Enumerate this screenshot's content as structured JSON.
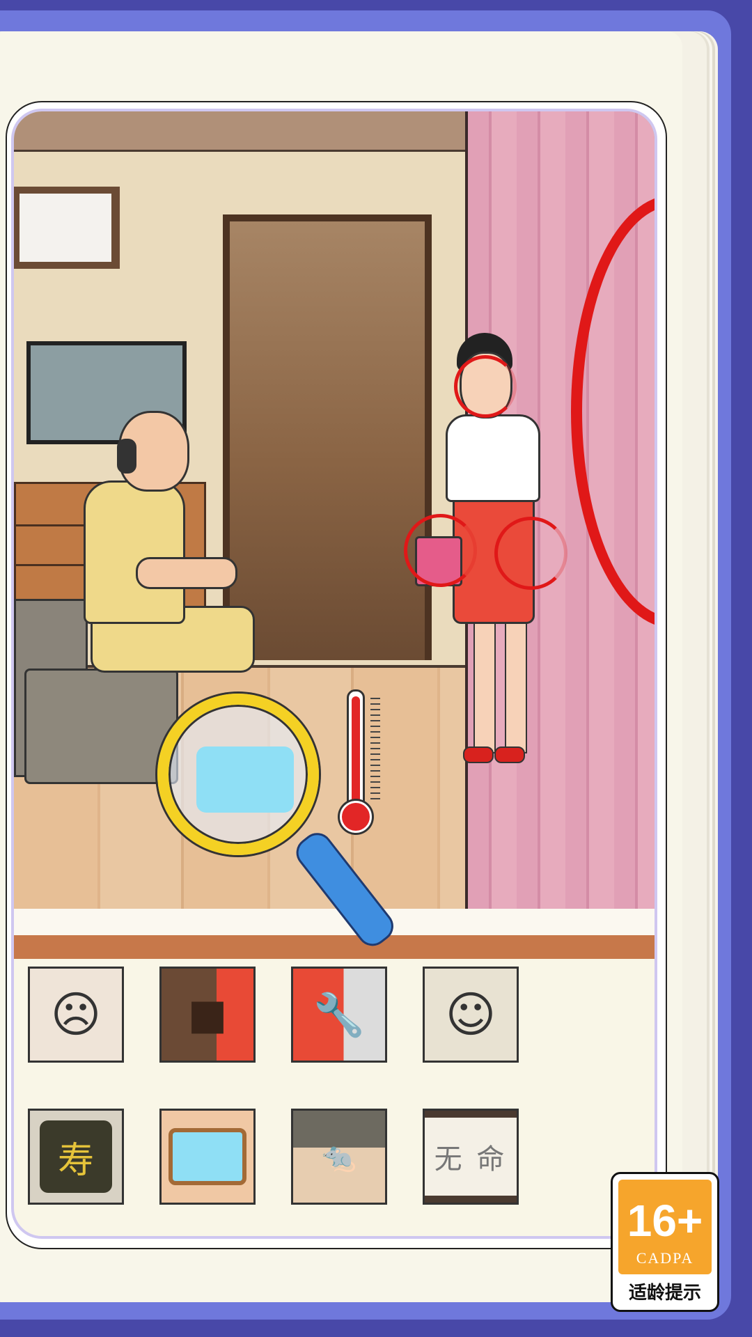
{
  "scene": {
    "clues": [
      {
        "id": "woman-crying",
        "icon": "crying-woman-icon",
        "text": ""
      },
      {
        "id": "box",
        "icon": "wooden-box-icon",
        "text": ""
      },
      {
        "id": "wrench",
        "icon": "wrench-icon",
        "text": ""
      },
      {
        "id": "smiling-woman",
        "icon": "smiling-woman-icon",
        "text": ""
      },
      {
        "id": "shou-jacket",
        "icon": "jacket-icon",
        "text": "寿"
      },
      {
        "id": "water-basin",
        "icon": "foot-basin-icon",
        "text": ""
      },
      {
        "id": "rats",
        "icon": "rats-icon",
        "text": ""
      },
      {
        "id": "scroll",
        "icon": "scroll-icon",
        "text": "无 命"
      }
    ]
  },
  "age_badge": {
    "age": "16+",
    "org": "CADPA",
    "label": "适龄提示"
  },
  "colors": {
    "frame": "#6f78dc",
    "hint_circle": "#e01818",
    "badge_orange": "#f6a52c"
  }
}
